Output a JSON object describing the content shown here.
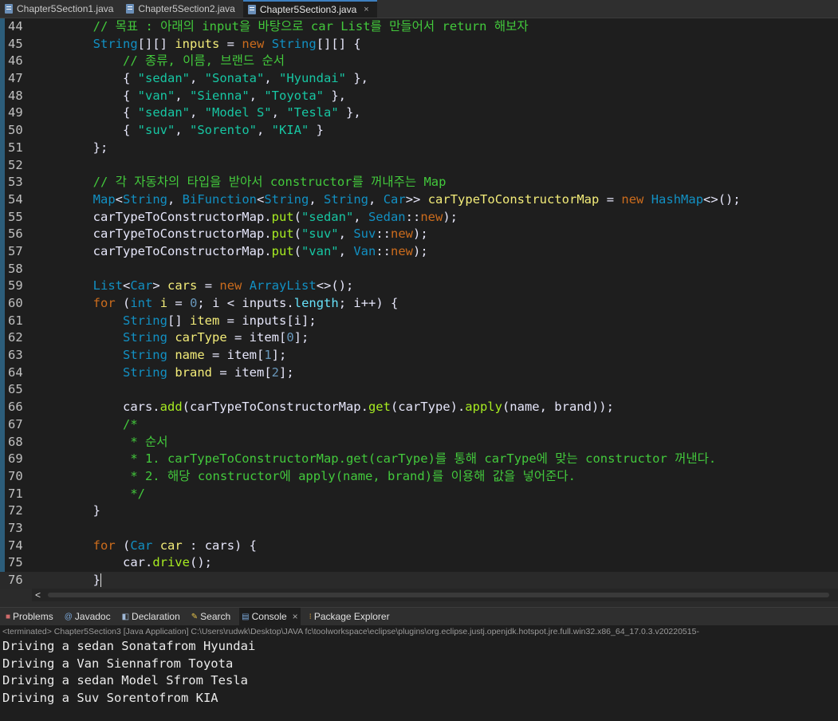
{
  "tabs": [
    {
      "label": "Chapter5Section1.java"
    },
    {
      "label": "Chapter5Section2.java"
    },
    {
      "label": "Chapter5Section3.java",
      "active": true,
      "close": "×"
    }
  ],
  "editor": {
    "line_numbers": [
      "44",
      "45",
      "46",
      "47",
      "48",
      "49",
      "50",
      "51",
      "52",
      "53",
      "54",
      "55",
      "56",
      "57",
      "58",
      "59",
      "60",
      "61",
      "62",
      "63",
      "64",
      "65",
      "66",
      "67",
      "68",
      "69",
      "70",
      "71",
      "72",
      "73",
      "74",
      "75",
      "76"
    ],
    "comment_goal": "// 목표 : 아래의 input을 바탕으로 car List를 만들어서 return 해보자",
    "comment_order": "// 종류, 이름, 브랜드 순서",
    "comment_map": "// 각 자동차의 타입을 받아서 constructor를 꺼내주는 Map",
    "comment_block": [
      "/*",
      " * 순서",
      " * 1. carTypeToConstructorMap.get(carType)를 통해 carType에 맞는 constructor 꺼낸다.",
      " * 2. 해당 constructor에 apply(name, brand)를 이용해 값을 넣어준다.",
      " */"
    ],
    "inputs": [
      [
        "\"sedan\"",
        "\"Sonata\"",
        "\"Hyundai\""
      ],
      [
        "\"van\"",
        "\"Sienna\"",
        "\"Toyota\""
      ],
      [
        "\"sedan\"",
        "\"Model S\"",
        "\"Tesla\""
      ],
      [
        "\"suv\"",
        "\"Sorento\"",
        "\"KIA\""
      ]
    ],
    "map_puts": [
      {
        "key": "\"sedan\"",
        "cls": "Sedan"
      },
      {
        "key": "\"suv\"",
        "cls": "Suv"
      },
      {
        "key": "\"van\"",
        "cls": "Van"
      }
    ],
    "scroll_arrow": "<"
  },
  "views": {
    "tabs": [
      {
        "label": "Problems",
        "icon": "problems-icon"
      },
      {
        "label": "Javadoc",
        "icon": "javadoc-icon"
      },
      {
        "label": "Declaration",
        "icon": "declaration-icon"
      },
      {
        "label": "Search",
        "icon": "search-icon"
      },
      {
        "label": "Console",
        "icon": "console-icon",
        "active": true,
        "close": "×"
      },
      {
        "label": "Package Explorer",
        "icon": "package-explorer-icon"
      }
    ],
    "status": "<terminated> Chapter5Section3 [Java Application] C:\\Users\\rudwk\\Desktop\\JAVA fc\\toolworkspace\\eclipse\\plugins\\org.eclipse.justj.openjdk.hotspot.jre.full.win32.x86_64_17.0.3.v20220515-",
    "output": [
      "Driving a sedan Sonatafrom Hyundai",
      "Driving a Van Siennafrom Toyota",
      "Driving a sedan Model Sfrom Tesla",
      "Driving a Suv Sorentofrom KIA"
    ]
  },
  "colors": {
    "keyword": "#cc6c1d",
    "type": "#1290c3",
    "comment": "#43c93c",
    "string": "#17c6a3",
    "method": "#a7ec21",
    "variable": "#f3ec79"
  }
}
